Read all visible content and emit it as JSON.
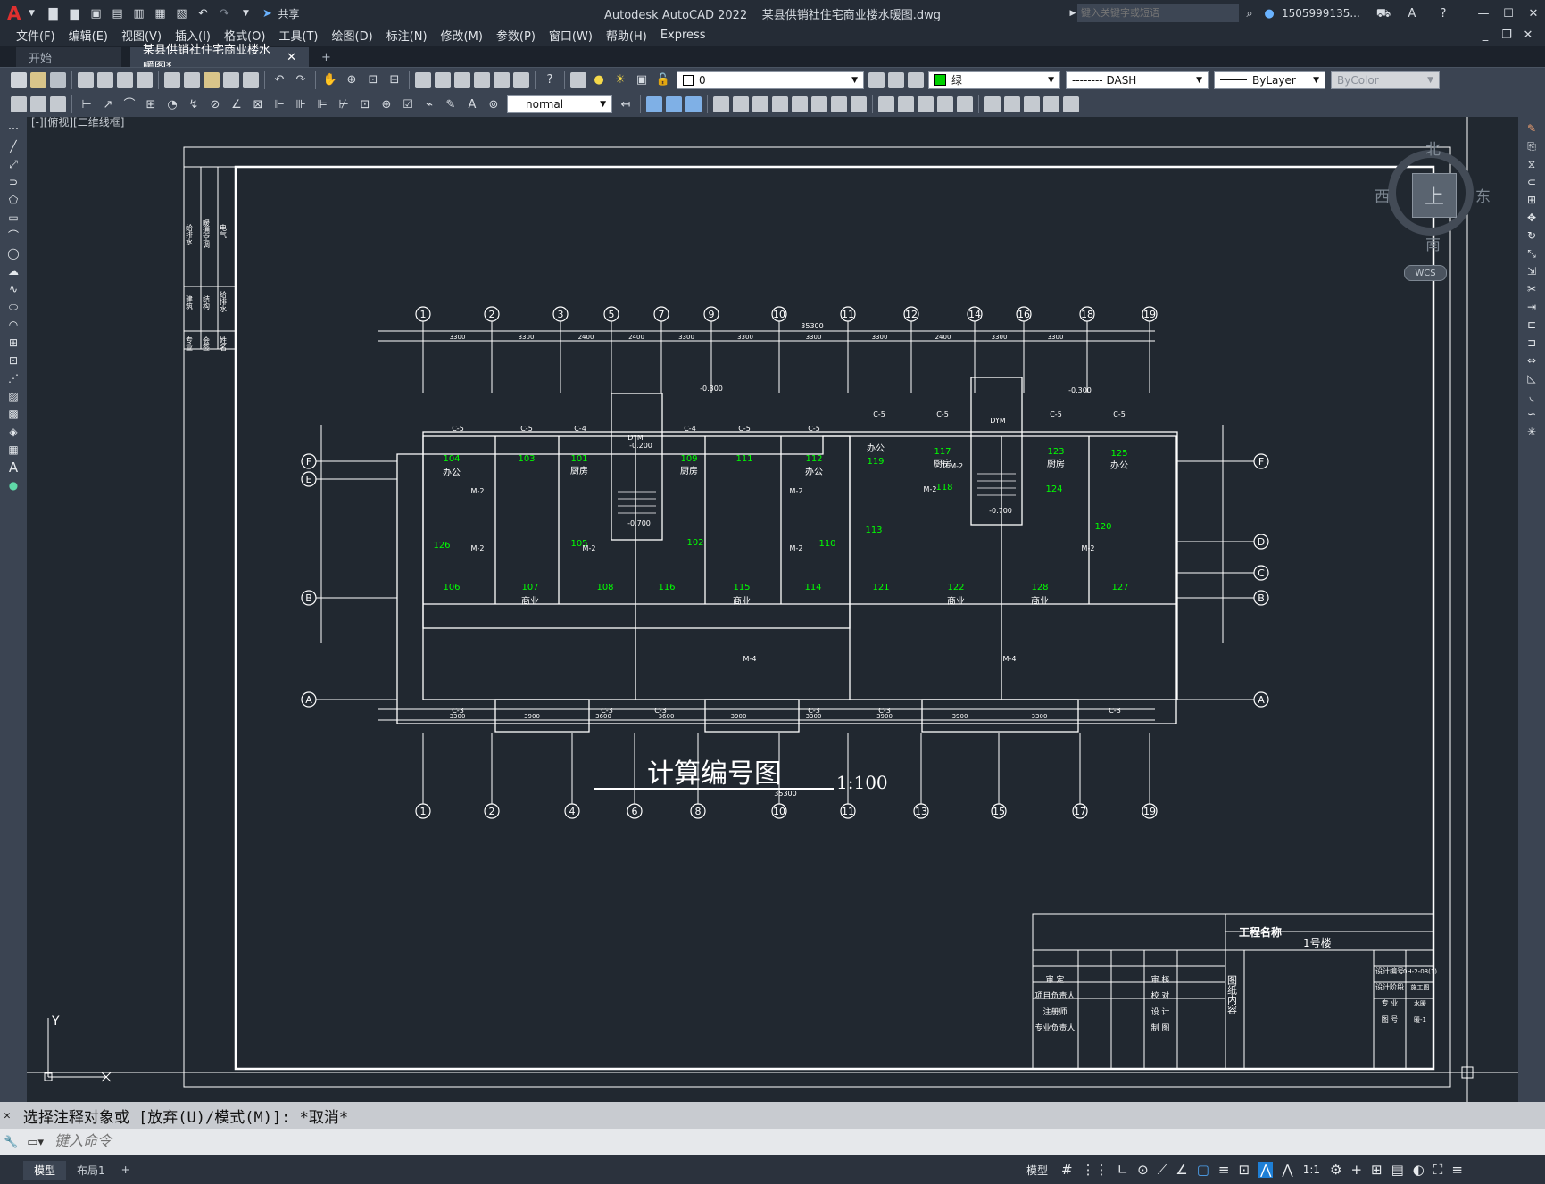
{
  "titlebar": {
    "app_title": "Autodesk AutoCAD 2022",
    "file_title": "某县供销社住宅商业楼水暖图.dwg",
    "share_label": "共享",
    "search_placeholder": "键入关键字或短语",
    "user": "1505999135...",
    "window_buttons": [
      "—",
      "☐",
      "✕"
    ]
  },
  "menu": [
    "文件(F)",
    "编辑(E)",
    "视图(V)",
    "插入(I)",
    "格式(O)",
    "工具(T)",
    "绘图(D)",
    "标注(N)",
    "修改(M)",
    "参数(P)",
    "窗口(W)",
    "帮助(H)",
    "Express"
  ],
  "tabs": [
    {
      "label": "开始",
      "active": false
    },
    {
      "label": "某县供销社住宅商业楼水暖图*",
      "active": true
    }
  ],
  "properties": {
    "layer": "0",
    "color": "绿",
    "linetype": "-------- DASH",
    "lineweight": "ByLayer",
    "plotstyle": "ByColor",
    "annotation_style": "normal"
  },
  "viewport": {
    "view_label": "[-][俯视][二维线框]",
    "viewcube": {
      "north": "北",
      "south": "南",
      "east": "东",
      "west": "西",
      "top": "上",
      "wcs": "WCS"
    },
    "ucs_y": "Y"
  },
  "drawing": {
    "title": "计算编号图",
    "scale": "1:100",
    "top_axes": [
      "1",
      "2",
      "3",
      "5",
      "7",
      "9",
      "10",
      "11",
      "12",
      "14",
      "16",
      "18",
      "19"
    ],
    "bottom_axes": [
      "1",
      "2",
      "4",
      "6",
      "8",
      "10",
      "11",
      "13",
      "15",
      "17",
      "19"
    ],
    "left_axes": [
      "F",
      "E",
      "B",
      "A"
    ],
    "right_axes": [
      "F",
      "D",
      "C",
      "B",
      "A"
    ],
    "top_dims": [
      "3300",
      "3300",
      "2400",
      "2400",
      "3300",
      "3300",
      "3300",
      "3300",
      "2400",
      "3300",
      "3300"
    ],
    "bottom_dims": [
      "3300",
      "3900",
      "3600",
      "3600",
      "3900",
      "3300",
      "3900",
      "3900",
      "3300"
    ],
    "total_dim": "35300",
    "rooms_green": [
      "104",
      "103",
      "101",
      "109",
      "111",
      "112",
      "117",
      "123",
      "125",
      "119",
      "118",
      "124",
      "126",
      "105",
      "102",
      "110",
      "113",
      "120",
      "106",
      "107",
      "108",
      "116",
      "115",
      "114",
      "121",
      "122",
      "128",
      "127"
    ],
    "room_names": [
      "办公",
      "厨房",
      "厨房",
      "办公",
      "办公",
      "厨房",
      "厨房",
      "办公",
      "商业",
      "商业",
      "商业",
      "商业"
    ],
    "labels": [
      "C-5",
      "C-4",
      "M-2",
      "M-4",
      "C-3",
      "DYM",
      "TLM-2",
      "-0.200",
      "-0.300",
      "-0.700"
    ],
    "side_title_block": [
      "给排水",
      "暖通空调",
      "电气",
      "建筑",
      "结构",
      "给排水",
      "专业",
      "会签",
      "姓名"
    ],
    "title_block": {
      "project_name_label": "工程名称",
      "project_name": "1号楼",
      "rows_left": [
        "审 定",
        "项目负责人",
        "注册师",
        "专业负责人"
      ],
      "rows_mid": [
        "审 核",
        "校 对",
        "设 计",
        "制 图"
      ],
      "content_label": "图纸内容",
      "rows_right": [
        "设计编号",
        "设计阶段",
        "专 业",
        "图 号"
      ],
      "values_right": [
        "0H-2-08(1)",
        "施工图",
        "水暖",
        "暖-1"
      ]
    }
  },
  "command": {
    "history": "选择注释对象或 [放弃(U)/模式(M)]: *取消*",
    "placeholder": "键入命令"
  },
  "status": {
    "layout_tabs": [
      "模型",
      "布局1"
    ],
    "model_label": "模型",
    "scale": "1:1"
  },
  "colors": {
    "accent": "#1e7fd6",
    "green_text": "#00ff00",
    "bg": "#212830"
  }
}
